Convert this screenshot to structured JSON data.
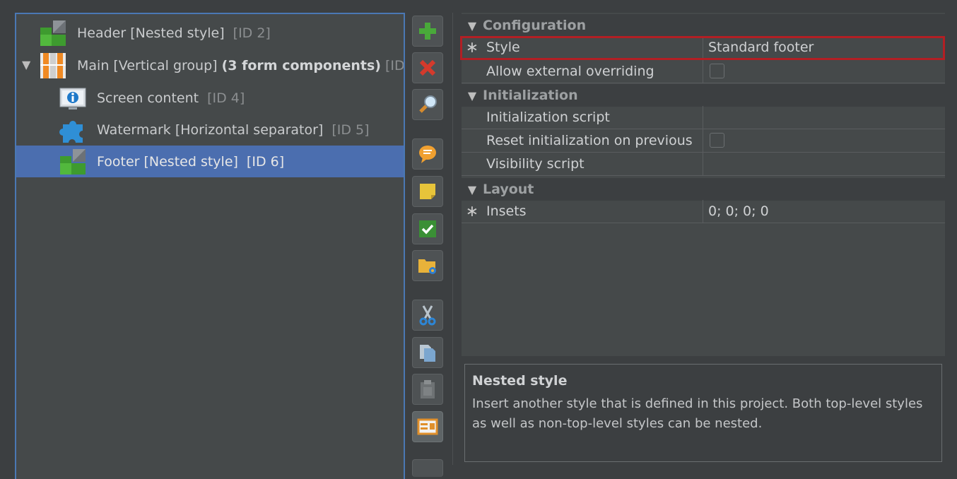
{
  "tree": {
    "items": [
      {
        "label": "Header [Nested style]",
        "bold": "",
        "id": "[ID 2]",
        "icon": "nested-style-icon"
      },
      {
        "label": "Main [Vertical group]",
        "bold": "(3 form components)",
        "id": "[ID...",
        "icon": "vertical-group-icon",
        "expander": "▼"
      },
      {
        "label": "Screen content",
        "bold": "",
        "id": "[ID 4]",
        "icon": "info-screen-icon"
      },
      {
        "label": "Watermark [Horizontal separator]",
        "bold": "",
        "id": "[ID 5]",
        "icon": "puzzle-piece-icon"
      },
      {
        "label": "Footer [Nested style]",
        "bold": "",
        "id": "[ID 6]",
        "icon": "nested-style-icon",
        "selected": true
      }
    ]
  },
  "toolbar": {
    "buttons": [
      {
        "name": "add",
        "icon": "plus-icon"
      },
      {
        "name": "delete",
        "icon": "red-x-icon"
      },
      {
        "name": "search",
        "icon": "magnifier-icon"
      },
      {
        "name": "comment",
        "icon": "speech-bubble-icon"
      },
      {
        "name": "note",
        "icon": "sticky-note-icon"
      },
      {
        "name": "check",
        "icon": "checkmark-icon"
      },
      {
        "name": "folder",
        "icon": "folder-gear-icon"
      },
      {
        "name": "cut",
        "icon": "scissors-icon"
      },
      {
        "name": "copy",
        "icon": "copy-icon"
      },
      {
        "name": "paste",
        "icon": "clipboard-icon"
      },
      {
        "name": "form",
        "icon": "form-preview-icon"
      }
    ]
  },
  "properties": {
    "sections": [
      {
        "title": "Configuration",
        "rows": [
          {
            "mark": "∗",
            "name": "Style",
            "value": "Standard footer"
          },
          {
            "mark": "",
            "name": "Allow external overriding",
            "checkbox": true
          }
        ]
      },
      {
        "title": "Initialization",
        "rows": [
          {
            "mark": "",
            "name": "Initialization script",
            "value": ""
          },
          {
            "mark": "",
            "name": "Reset initialization on previous",
            "checkbox": true
          },
          {
            "mark": "",
            "name": "Visibility script",
            "value": ""
          }
        ]
      },
      {
        "title": "Layout",
        "rows": [
          {
            "mark": "∗",
            "name": "Insets",
            "value": "0; 0; 0; 0"
          }
        ]
      }
    ],
    "section_glyph": "▼"
  },
  "description": {
    "title": "Nested style",
    "body": "Insert another style that is defined in this project. Both top-level styles as well as non-top-level styles can be nested."
  },
  "colors": {
    "selection": "#4b6eaf",
    "highlight_border": "#b21f24",
    "panel_border": "#4a78b4"
  }
}
